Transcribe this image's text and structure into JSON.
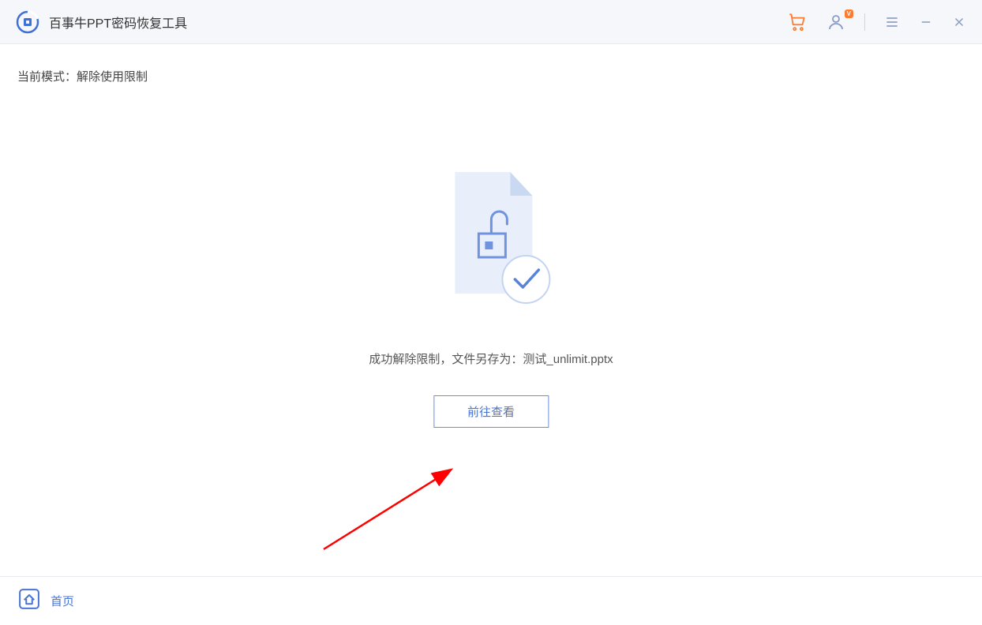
{
  "header": {
    "app_title": "百事牛PPT密码恢复工具",
    "vip_badge": "V"
  },
  "main": {
    "mode_label": "当前模式：",
    "mode_value": "解除使用限制",
    "success_prefix": "成功解除限制，文件另存为：",
    "saved_filename": "测试_unlimit.pptx",
    "view_button_label": "前往查看"
  },
  "footer": {
    "home_label": "首页"
  }
}
